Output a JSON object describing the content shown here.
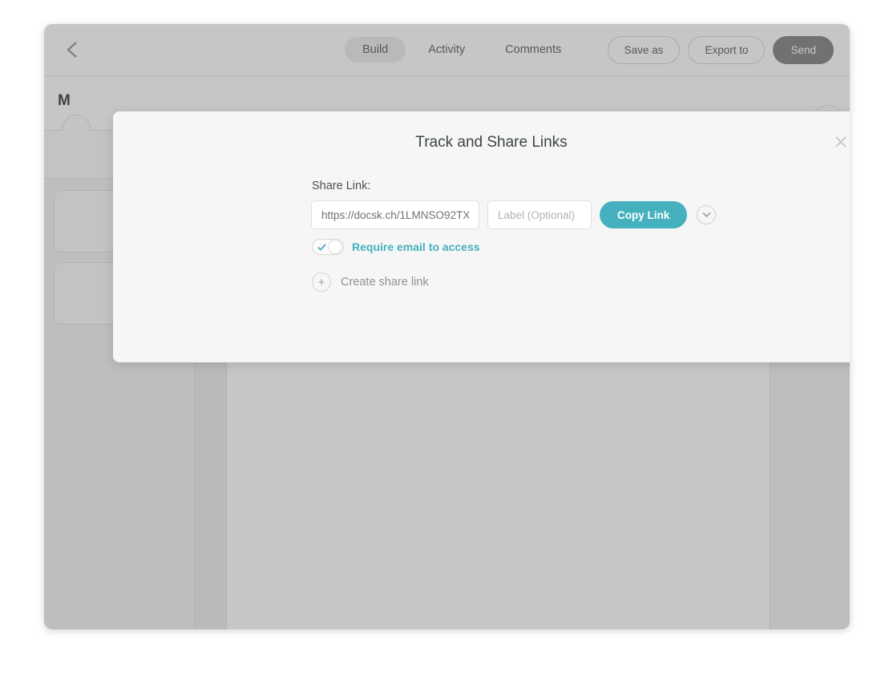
{
  "app": {
    "back_icon": "chevron-left-icon",
    "tabs": [
      {
        "label": "Build",
        "active": true
      },
      {
        "label": "Activity",
        "active": false
      },
      {
        "label": "Comments",
        "active": false
      }
    ],
    "actions": {
      "save_as": "Save as",
      "export_to": "Export to",
      "send": "Send"
    },
    "page_title": "M",
    "accent_teal": "#45b1bf",
    "primary_teal": "#1d8290"
  },
  "modal": {
    "title": "Track and Share Links",
    "close_icon": "close-icon",
    "share_link_label": "Share Link:",
    "url_value": "https://docsk.ch/1LMNSO92TX",
    "label_placeholder": "Label (Optional)",
    "copy_link_button": "Copy Link",
    "expand_icon": "chevron-down-icon",
    "require_email_label": "Require email to access",
    "require_email_checked": true,
    "create_share_link_label": "Create share link",
    "create_share_link_icon": "plus-circle-icon"
  }
}
